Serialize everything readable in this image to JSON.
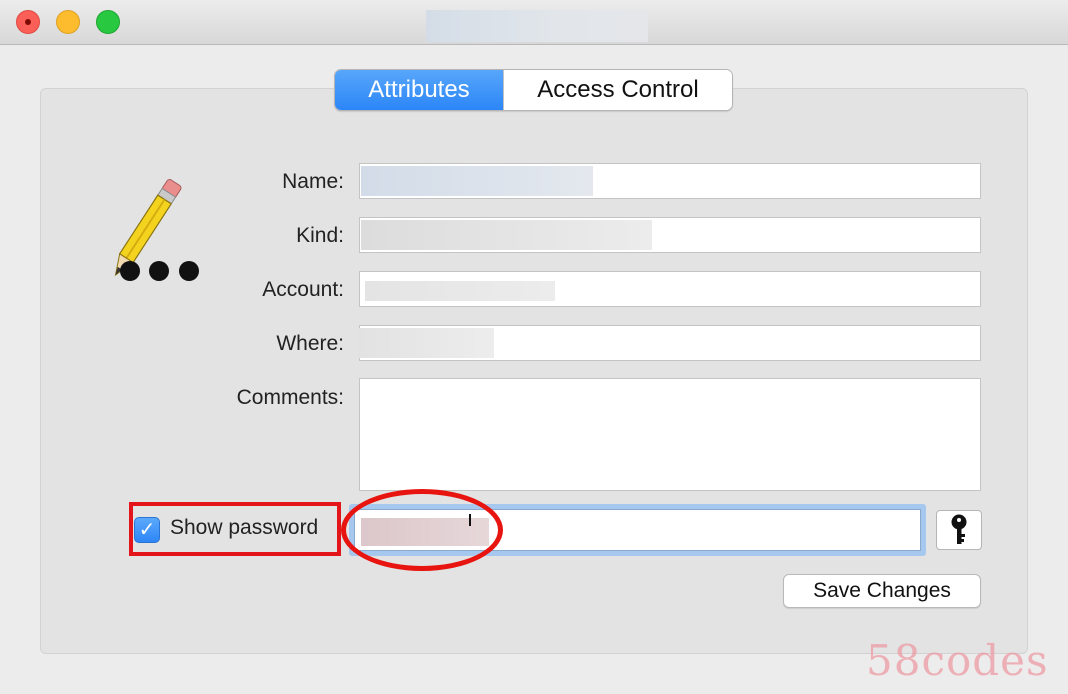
{
  "window": {
    "title": ""
  },
  "tabs": [
    {
      "label": "Attributes",
      "active": true
    },
    {
      "label": "Access Control",
      "active": false
    }
  ],
  "form": {
    "name_label": "Name:",
    "kind_label": "Kind:",
    "account_label": "Account:",
    "where_label": "Where:",
    "comments_label": "Comments:",
    "comments_value": ""
  },
  "password": {
    "show_label": "Show password",
    "show_checked": true,
    "checkmark": "✓"
  },
  "actions": {
    "save_label": "Save Changes"
  },
  "icons": {
    "app_icon": "pencil-password-icon",
    "key_icon": "key-icon"
  },
  "colors": {
    "accent": "#2c86f7",
    "annotation": "#e3151a"
  },
  "watermark": "58codes"
}
